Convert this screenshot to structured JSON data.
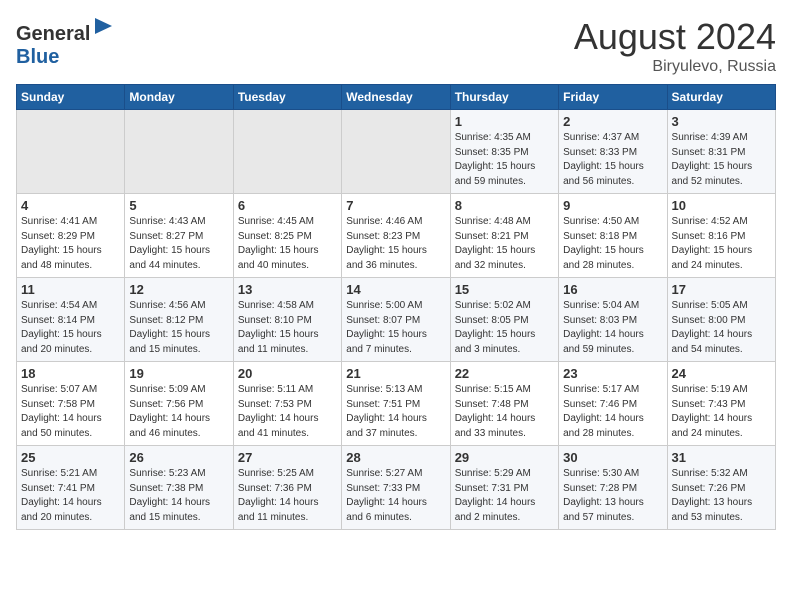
{
  "header": {
    "logo_general": "General",
    "logo_blue": "Blue",
    "month_year": "August 2024",
    "location": "Biryulevo, Russia"
  },
  "weekdays": [
    "Sunday",
    "Monday",
    "Tuesday",
    "Wednesday",
    "Thursday",
    "Friday",
    "Saturday"
  ],
  "weeks": [
    [
      {
        "day": "",
        "info": ""
      },
      {
        "day": "",
        "info": ""
      },
      {
        "day": "",
        "info": ""
      },
      {
        "day": "",
        "info": ""
      },
      {
        "day": "1",
        "info": "Sunrise: 4:35 AM\nSunset: 8:35 PM\nDaylight: 15 hours\nand 59 minutes."
      },
      {
        "day": "2",
        "info": "Sunrise: 4:37 AM\nSunset: 8:33 PM\nDaylight: 15 hours\nand 56 minutes."
      },
      {
        "day": "3",
        "info": "Sunrise: 4:39 AM\nSunset: 8:31 PM\nDaylight: 15 hours\nand 52 minutes."
      }
    ],
    [
      {
        "day": "4",
        "info": "Sunrise: 4:41 AM\nSunset: 8:29 PM\nDaylight: 15 hours\nand 48 minutes."
      },
      {
        "day": "5",
        "info": "Sunrise: 4:43 AM\nSunset: 8:27 PM\nDaylight: 15 hours\nand 44 minutes."
      },
      {
        "day": "6",
        "info": "Sunrise: 4:45 AM\nSunset: 8:25 PM\nDaylight: 15 hours\nand 40 minutes."
      },
      {
        "day": "7",
        "info": "Sunrise: 4:46 AM\nSunset: 8:23 PM\nDaylight: 15 hours\nand 36 minutes."
      },
      {
        "day": "8",
        "info": "Sunrise: 4:48 AM\nSunset: 8:21 PM\nDaylight: 15 hours\nand 32 minutes."
      },
      {
        "day": "9",
        "info": "Sunrise: 4:50 AM\nSunset: 8:18 PM\nDaylight: 15 hours\nand 28 minutes."
      },
      {
        "day": "10",
        "info": "Sunrise: 4:52 AM\nSunset: 8:16 PM\nDaylight: 15 hours\nand 24 minutes."
      }
    ],
    [
      {
        "day": "11",
        "info": "Sunrise: 4:54 AM\nSunset: 8:14 PM\nDaylight: 15 hours\nand 20 minutes."
      },
      {
        "day": "12",
        "info": "Sunrise: 4:56 AM\nSunset: 8:12 PM\nDaylight: 15 hours\nand 15 minutes."
      },
      {
        "day": "13",
        "info": "Sunrise: 4:58 AM\nSunset: 8:10 PM\nDaylight: 15 hours\nand 11 minutes."
      },
      {
        "day": "14",
        "info": "Sunrise: 5:00 AM\nSunset: 8:07 PM\nDaylight: 15 hours\nand 7 minutes."
      },
      {
        "day": "15",
        "info": "Sunrise: 5:02 AM\nSunset: 8:05 PM\nDaylight: 15 hours\nand 3 minutes."
      },
      {
        "day": "16",
        "info": "Sunrise: 5:04 AM\nSunset: 8:03 PM\nDaylight: 14 hours\nand 59 minutes."
      },
      {
        "day": "17",
        "info": "Sunrise: 5:05 AM\nSunset: 8:00 PM\nDaylight: 14 hours\nand 54 minutes."
      }
    ],
    [
      {
        "day": "18",
        "info": "Sunrise: 5:07 AM\nSunset: 7:58 PM\nDaylight: 14 hours\nand 50 minutes."
      },
      {
        "day": "19",
        "info": "Sunrise: 5:09 AM\nSunset: 7:56 PM\nDaylight: 14 hours\nand 46 minutes."
      },
      {
        "day": "20",
        "info": "Sunrise: 5:11 AM\nSunset: 7:53 PM\nDaylight: 14 hours\nand 41 minutes."
      },
      {
        "day": "21",
        "info": "Sunrise: 5:13 AM\nSunset: 7:51 PM\nDaylight: 14 hours\nand 37 minutes."
      },
      {
        "day": "22",
        "info": "Sunrise: 5:15 AM\nSunset: 7:48 PM\nDaylight: 14 hours\nand 33 minutes."
      },
      {
        "day": "23",
        "info": "Sunrise: 5:17 AM\nSunset: 7:46 PM\nDaylight: 14 hours\nand 28 minutes."
      },
      {
        "day": "24",
        "info": "Sunrise: 5:19 AM\nSunset: 7:43 PM\nDaylight: 14 hours\nand 24 minutes."
      }
    ],
    [
      {
        "day": "25",
        "info": "Sunrise: 5:21 AM\nSunset: 7:41 PM\nDaylight: 14 hours\nand 20 minutes."
      },
      {
        "day": "26",
        "info": "Sunrise: 5:23 AM\nSunset: 7:38 PM\nDaylight: 14 hours\nand 15 minutes."
      },
      {
        "day": "27",
        "info": "Sunrise: 5:25 AM\nSunset: 7:36 PM\nDaylight: 14 hours\nand 11 minutes."
      },
      {
        "day": "28",
        "info": "Sunrise: 5:27 AM\nSunset: 7:33 PM\nDaylight: 14 hours\nand 6 minutes."
      },
      {
        "day": "29",
        "info": "Sunrise: 5:29 AM\nSunset: 7:31 PM\nDaylight: 14 hours\nand 2 minutes."
      },
      {
        "day": "30",
        "info": "Sunrise: 5:30 AM\nSunset: 7:28 PM\nDaylight: 13 hours\nand 57 minutes."
      },
      {
        "day": "31",
        "info": "Sunrise: 5:32 AM\nSunset: 7:26 PM\nDaylight: 13 hours\nand 53 minutes."
      }
    ]
  ]
}
